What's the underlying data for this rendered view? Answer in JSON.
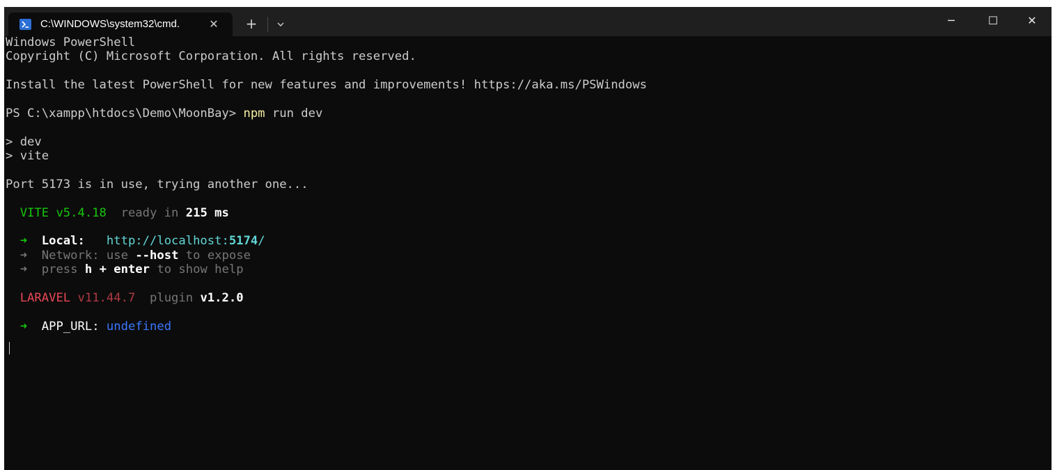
{
  "tab": {
    "title": "C:\\WINDOWS\\system32\\cmd.",
    "close": "✕",
    "new_tab": "+",
    "icon": "powershell-icon"
  },
  "window_controls": {
    "minimize": "─",
    "maximize": "☐",
    "close": "✕"
  },
  "colors": {
    "background": "#0c0c0c",
    "titlebar": "#1f1f1f",
    "text": "#cccccc",
    "yellow": "#f9f1a5",
    "green": "#16c60c",
    "gray": "#767676",
    "cyan": "#61d6d6",
    "red": "#e74856",
    "blue": "#3b78ff"
  },
  "terminal": {
    "l1": "Windows PowerShell",
    "l2": "Copyright (C) Microsoft Corporation. All rights reserved.",
    "l3": "Install the latest PowerShell for new features and improvements! https://aka.ms/PSWindows",
    "prompt": "PS C:\\xampp\\htdocs\\Demo\\MoonBay> ",
    "cmd_npm": "npm",
    "cmd_rest": " run dev",
    "dev": "> dev",
    "vite_cmd": "> vite",
    "port": "Port 5173 is in use, trying another one...",
    "vite": {
      "name": "VITE v5.4.18",
      "ready": "ready in",
      "time": "215",
      "unit": "ms"
    },
    "local": {
      "arrow": "➜",
      "label": "Local:",
      "url_a": "http://localhost:",
      "port": "5174",
      "url_b": "/"
    },
    "network": {
      "arrow": "➜",
      "label": "Network:",
      "use": "use",
      "flag": "--host",
      "rest": "to expose"
    },
    "help": {
      "arrow": "➜",
      "press": "press",
      "keys": "h + enter",
      "rest": "to show help"
    },
    "laravel": {
      "name": "LARAVEL",
      "version": "v11.44.7",
      "plugin": "plugin",
      "plugin_version": "v1.2.0"
    },
    "app_url": {
      "arrow": "➜",
      "label": "APP_URL:",
      "value": "undefined"
    }
  }
}
